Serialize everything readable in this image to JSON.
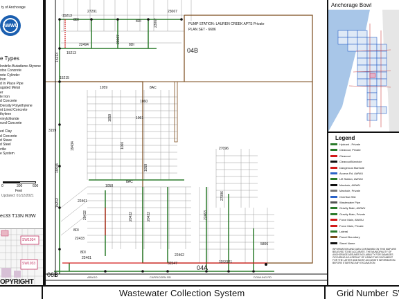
{
  "left_panel": {
    "agency": "ty of Anchorage",
    "logo_text": "AWWU",
    "pipe_types_title": "e Types",
    "pipe_types": [
      "lonitrile-Butadiene-Styrene",
      "stos Concrete",
      "rete Cylinder",
      "Iron",
      "d In Place Pipe",
      "ugated Metal",
      "er",
      "le Iron",
      "d Concrete",
      "Density Polyethylene",
      "nt Lined Concrete",
      "thylene",
      "vinylchloride",
      "rced Concrete",
      "",
      "ed Clay",
      "d Concrete",
      "d Stave",
      "d Steel",
      "ctile",
      "e System"
    ],
    "scale_labels": [
      "0",
      "300",
      "600"
    ],
    "scale_unit": "Feet",
    "updated": "Updated: 01/12/2021",
    "section": "ec33 T13N R3W",
    "inset_labels": [
      "SW1933",
      "SW1934"
    ]
  },
  "map": {
    "plan_label_1": "PUMP STATION: LAUREN CREEK APTS Private",
    "plan_label_2": "PLAN SET - 6686",
    "grid_labels": [
      "04B",
      "04A",
      "06B"
    ],
    "numbers": [
      "27291",
      "23067",
      "15213",
      "22494",
      "15213",
      "15215",
      "1059",
      "1060",
      "1061",
      "1058",
      "1059",
      "1060",
      "1059",
      "3159",
      "19434",
      "15212",
      "19434",
      "27096",
      "27096",
      "20432",
      "20432",
      "20432",
      "12134",
      "22459",
      "22433",
      "22461",
      "22462",
      "22463",
      "32547",
      "1153121",
      "5806",
      "15121"
    ],
    "labels": [
      "8DI",
      "8DI",
      "8DI",
      "8AC",
      "8AC",
      "8AC",
      "8AC",
      "8AC",
      "8DI",
      "8DI",
      "8DI",
      "8DI"
    ],
    "roads": [
      "DOWLING RD",
      "CAPRICORN RD",
      "ARAGO"
    ]
  },
  "right_panel": {
    "overview_title": "Anchorage Bowl",
    "legend_title": "Legend",
    "legend_items": [
      "Hydrant - Private",
      "Cleanout, Private",
      "Cleanout",
      "Cleanout/Manhole",
      "Dangerous Manhole",
      "Access Rd, AWWU",
      "Lift Station, AWWU",
      "Manhole, AWWU",
      "Manhole, Private",
      "Overflow Site",
      "Wastewater Pipe",
      "Gravity Main, AWWU",
      "Gravity Main, Private",
      "Force Main, AWWU",
      "Force Main, Private",
      "Lateral",
      "Parcel Boundary",
      "Street Name"
    ],
    "disclaimer": "INFORMATION AND DATA CONTAINED ON THIS MAP ARE BELIEVED TO BE ACCURATE. THE MUNICIPALITY OF ANCHORAGE ASSUMES NO LIABILITY FOR DAMAGES OCCURING AS A RESULT OF USING THIS DOCUMENT FOR THE LATEST AND MOST ACCURATE INFORMATION. BEFORE STARTING ANY EXCAVATION"
  },
  "bottom_bar": {
    "copyright": "OPYRIGHT",
    "title": "Wastewater Collection System",
    "grid_label": "Grid Number",
    "grid_value": "SW"
  },
  "colors": {
    "gravity_main": "#2a7a2a",
    "force_main": "#d21a1a",
    "boundary": "#7a4a1a",
    "parcel": "#888888",
    "inset_water": "#a8c6e8",
    "legend_blue": "#2b63c8"
  }
}
